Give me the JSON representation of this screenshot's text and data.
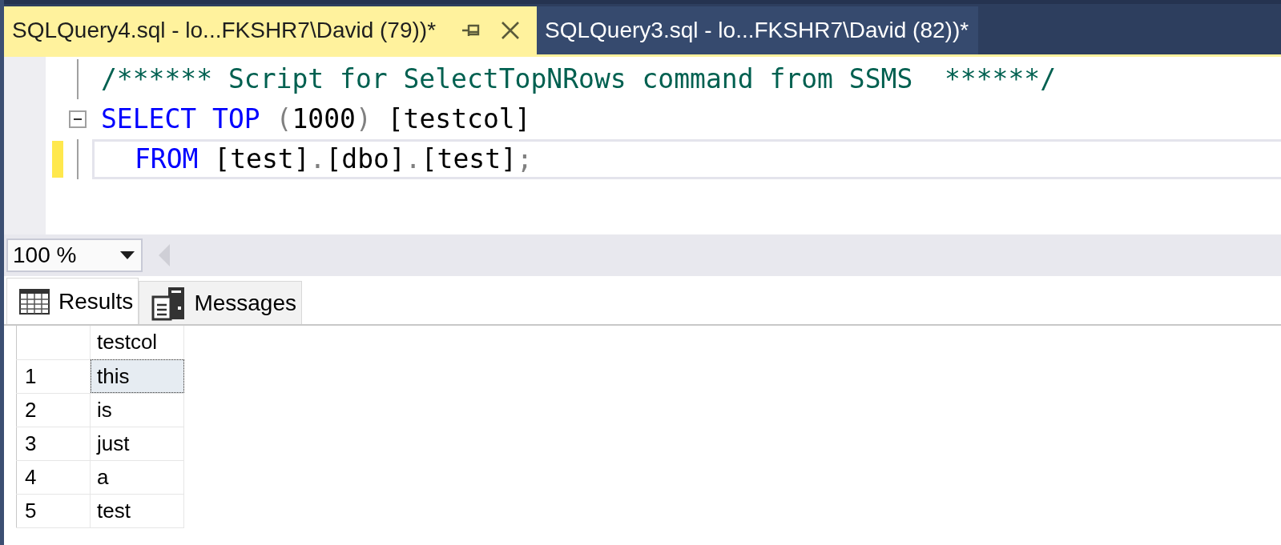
{
  "tabs": [
    {
      "label": "SQLQuery4.sql - lo...FKSHR7\\David (79))*",
      "selected": true
    },
    {
      "label": "SQLQuery3.sql - lo...FKSHR7\\David (82))*",
      "selected": false
    }
  ],
  "editor": {
    "lines": [
      {
        "indented": false,
        "collapsible": false,
        "current": false,
        "tokens": [
          {
            "kind": "comment",
            "text": "/****** Script for SelectTopNRows command from SSMS  ******/"
          }
        ]
      },
      {
        "indented": false,
        "collapsible": true,
        "current": false,
        "tokens": [
          {
            "kind": "keyword",
            "text": "SELECT"
          },
          {
            "kind": "keyword",
            "text": " TOP"
          },
          {
            "kind": "punct",
            "text": " ("
          },
          {
            "kind": "plain",
            "text": "1000"
          },
          {
            "kind": "punct",
            "text": ")"
          },
          {
            "kind": "plain",
            "text": " [testcol]"
          }
        ]
      },
      {
        "indented": true,
        "collapsible": false,
        "current": true,
        "tokens": [
          {
            "kind": "keyword",
            "text": "FROM"
          },
          {
            "kind": "plain",
            "text": " [test]"
          },
          {
            "kind": "punct",
            "text": "."
          },
          {
            "kind": "plain",
            "text": "[dbo]"
          },
          {
            "kind": "punct",
            "text": "."
          },
          {
            "kind": "plain",
            "text": "[test]"
          },
          {
            "kind": "punct",
            "text": ";"
          }
        ]
      }
    ]
  },
  "zoom": {
    "value": "100 %"
  },
  "result_tabs": [
    {
      "label": "Results",
      "kind": "grid",
      "selected": true
    },
    {
      "label": "Messages",
      "kind": "messages",
      "selected": false
    }
  ],
  "grid": {
    "columns": [
      "testcol"
    ],
    "rows": [
      {
        "number": "1",
        "cells": [
          "this"
        ],
        "selected": true
      },
      {
        "number": "2",
        "cells": [
          "is"
        ],
        "selected": false
      },
      {
        "number": "3",
        "cells": [
          "just"
        ],
        "selected": false
      },
      {
        "number": "4",
        "cells": [
          "a"
        ],
        "selected": false
      },
      {
        "number": "5",
        "cells": [
          "test"
        ],
        "selected": false
      }
    ]
  }
}
